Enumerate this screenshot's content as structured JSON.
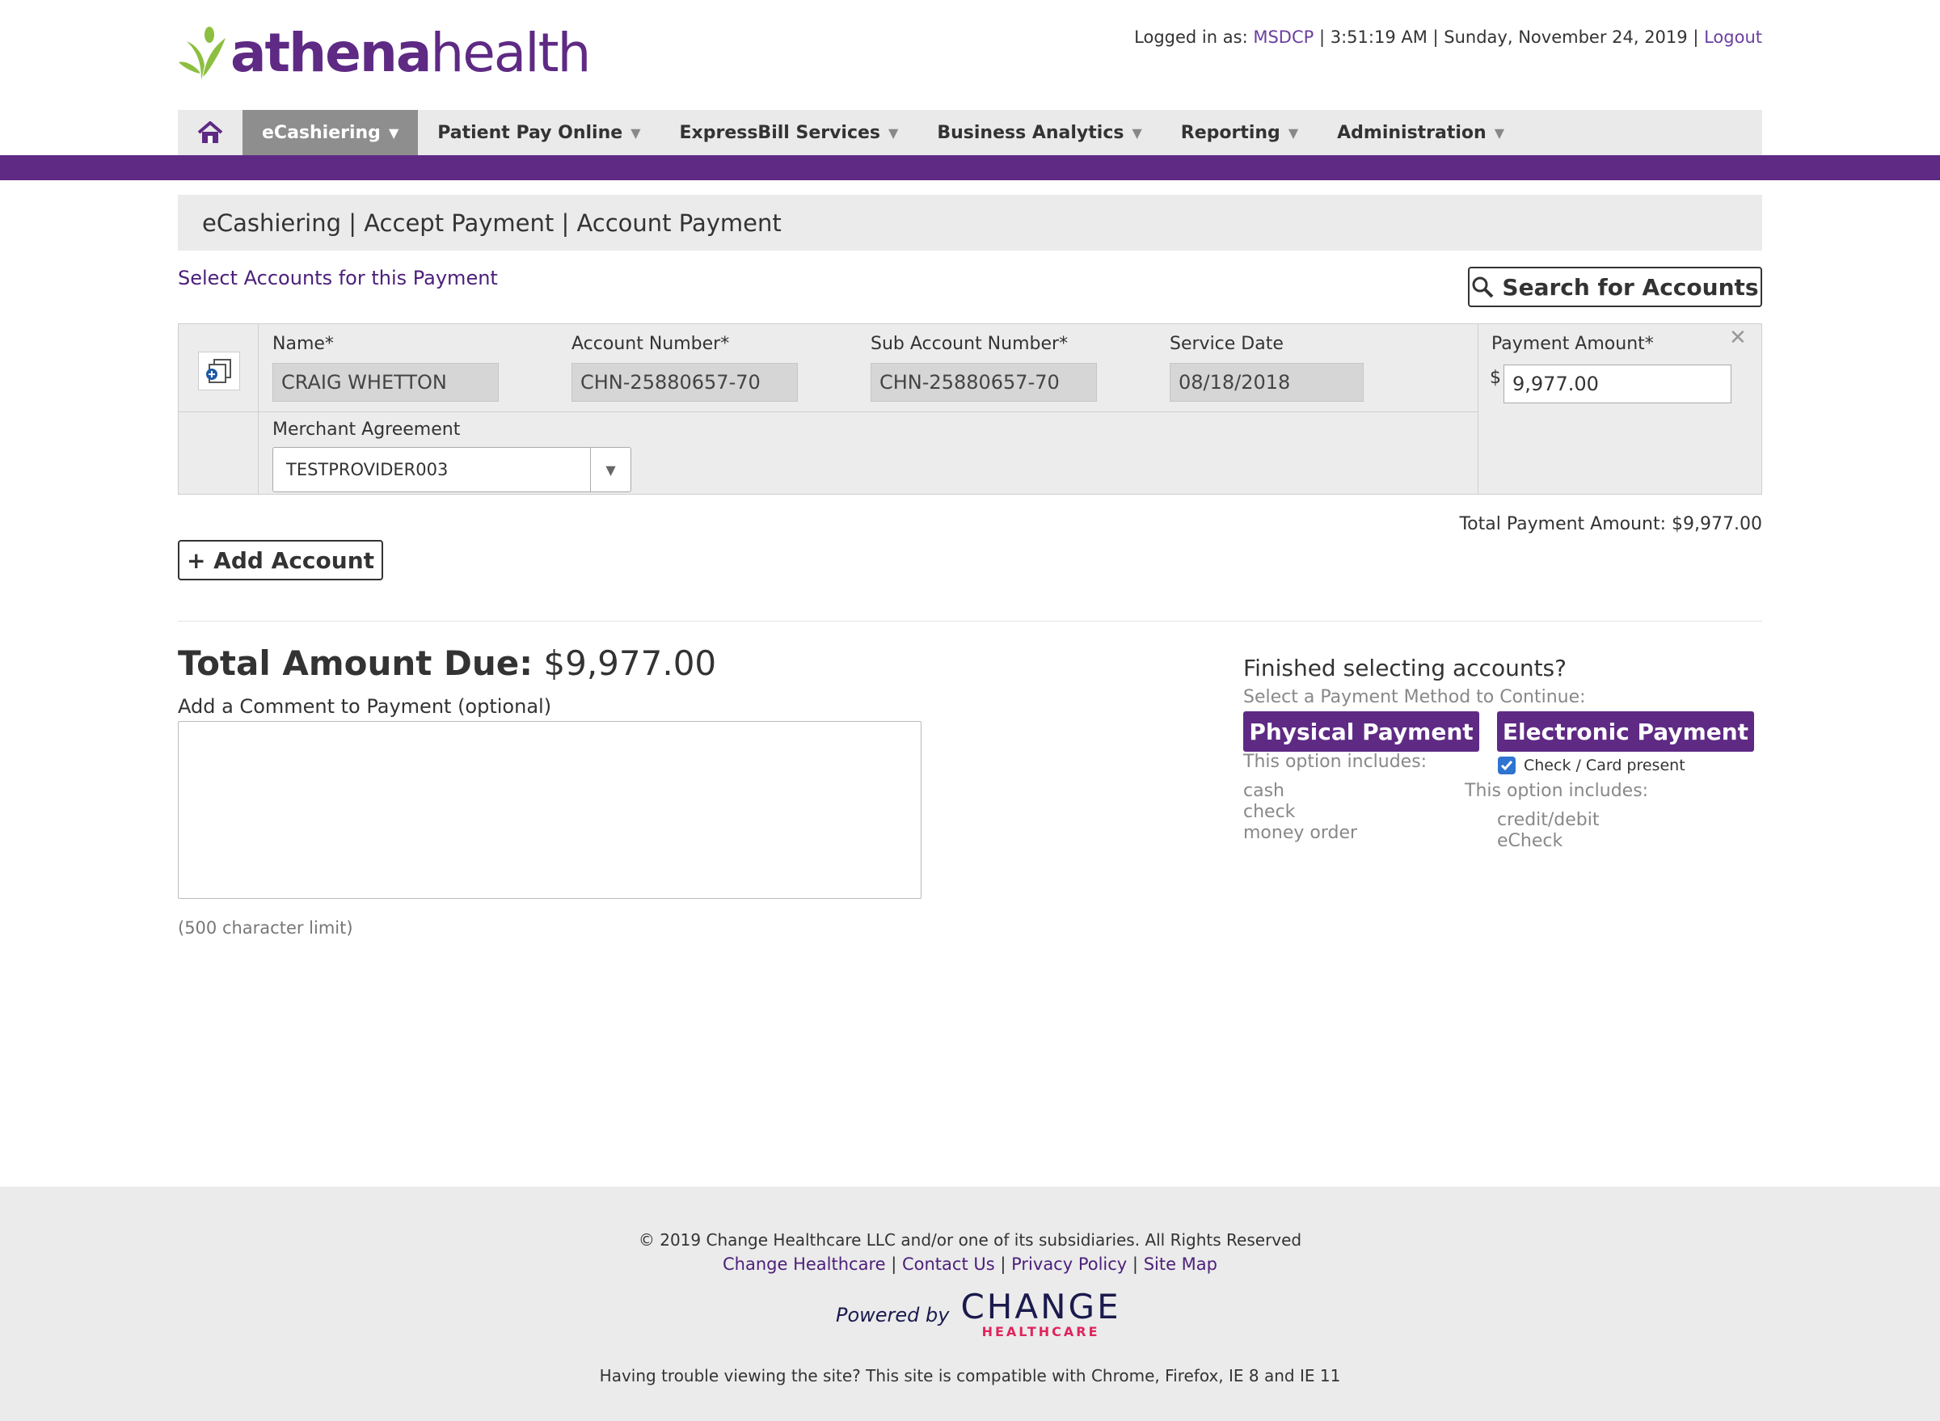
{
  "brand": {
    "logo_part1": "athena",
    "logo_part2": "health",
    "leaf_color": "#8cbf3f",
    "brand_color": "#5e2a84"
  },
  "userbar": {
    "logged_in_label": "Logged in as:",
    "user": "MSDCP",
    "time": "3:51:19 AM",
    "date": "Sunday, November 24, 2019",
    "logout": "Logout"
  },
  "nav": {
    "home_icon": "home-icon",
    "items": [
      {
        "label": "eCashiering",
        "active": true
      },
      {
        "label": "Patient Pay Online"
      },
      {
        "label": "ExpressBill Services"
      },
      {
        "label": "Business Analytics"
      },
      {
        "label": "Reporting"
      },
      {
        "label": "Administration"
      }
    ]
  },
  "breadcrumb": "eCashiering | Accept Payment | Account Payment",
  "select_title": "Select Accounts for this Payment",
  "search_button": "Search for Accounts",
  "account": {
    "name_label": "Name*",
    "name": "CRAIG WHETTON",
    "acct_label": "Account Number*",
    "acct": "CHN-25880657-70",
    "sub_label": "Sub Account Number*",
    "sub": "CHN-25880657-70",
    "date_label": "Service Date",
    "date": "08/18/2018",
    "pay_label": "Payment Amount*",
    "currency": "$",
    "pay": "9,977.00",
    "merchant_label": "Merchant Agreement",
    "merchant": "TESTPROVIDER003"
  },
  "total_payment": "Total Payment Amount: $9,977.00",
  "add_account": "+ Add Account",
  "due": {
    "label": "Total Amount Due:",
    "value": "$9,977.00"
  },
  "comment": {
    "label": "Add a Comment to Payment (optional)",
    "limit": "(500 character limit)"
  },
  "finish": {
    "title": "Finished selecting accounts?",
    "sub": "Select a Payment Method to Continue:",
    "physical": "Physical Payment",
    "electronic": "Electronic Payment",
    "phys_includes": "This option includes:",
    "phys_opts": [
      "cash",
      "check",
      "money order"
    ],
    "check_label": "Check / Card present",
    "elec_includes": "This option includes:",
    "elec_opts": [
      "credit/debit",
      "eCheck"
    ]
  },
  "footer": {
    "copyright": "© 2019 Change Healthcare LLC and/or one of its subsidiaries. All Rights Reserved",
    "links": [
      "Change Healthcare",
      "Contact Us",
      "Privacy Policy",
      "Site Map"
    ],
    "powered_by": "Powered by",
    "logo_main": "CHANGE",
    "logo_sub": "HEALTHCARE",
    "compat": "Having trouble viewing the site? This site is compatible with Chrome, Firefox, IE 8 and IE 11"
  }
}
